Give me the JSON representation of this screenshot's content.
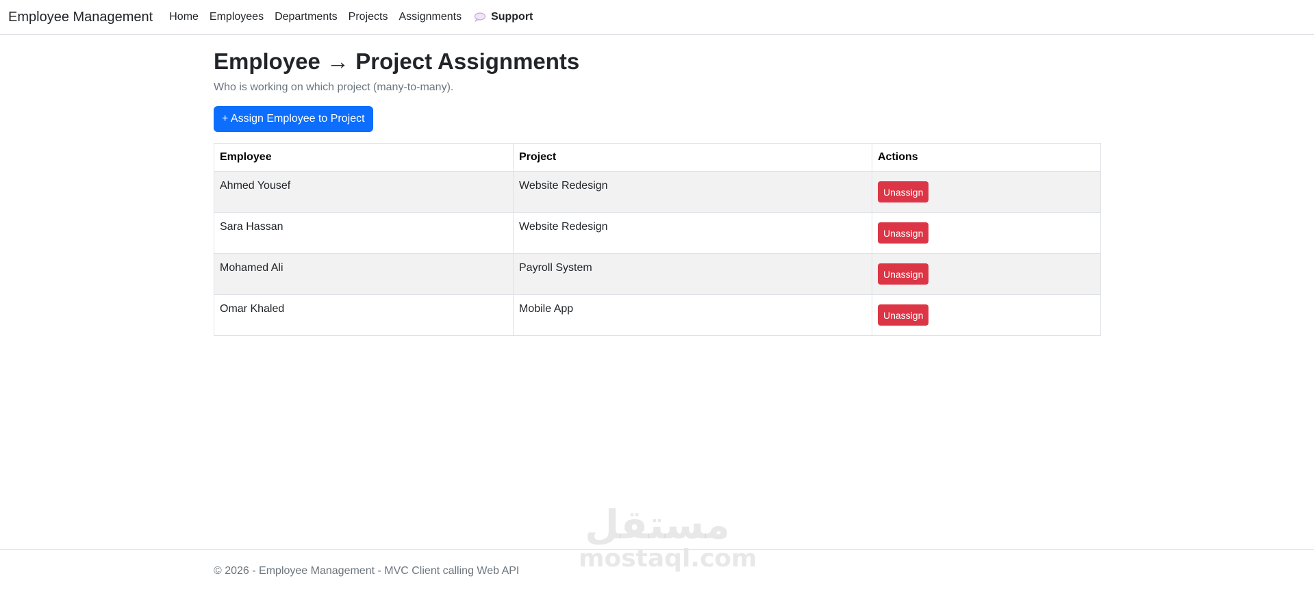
{
  "navbar": {
    "brand": "Employee Management",
    "links": [
      "Home",
      "Employees",
      "Departments",
      "Projects",
      "Assignments"
    ],
    "support_label": "Support",
    "support_icon": "speech-bubble-icon"
  },
  "page": {
    "title": "Employee → Project Assignments",
    "subtitle": "Who is working on which project (many-to-many).",
    "assign_button": "+ Assign Employee to Project"
  },
  "table": {
    "headers": [
      "Employee",
      "Project",
      "Actions"
    ],
    "rows": [
      {
        "employee": "Ahmed Yousef",
        "project": "Website Redesign",
        "action": "Unassign"
      },
      {
        "employee": "Sara Hassan",
        "project": "Website Redesign",
        "action": "Unassign"
      },
      {
        "employee": "Mohamed Ali",
        "project": "Payroll System",
        "action": "Unassign"
      },
      {
        "employee": "Omar Khaled",
        "project": "Mobile App",
        "action": "Unassign"
      }
    ]
  },
  "watermark": {
    "arabic": "مستقل",
    "latin": "mostaql.com"
  },
  "footer": {
    "text": "© 2026 - Employee Management - MVC Client calling Web API"
  },
  "colors": {
    "primary": "#0d6efd",
    "danger": "#dc3545",
    "muted": "#6c757d",
    "border": "#dee2e6"
  }
}
